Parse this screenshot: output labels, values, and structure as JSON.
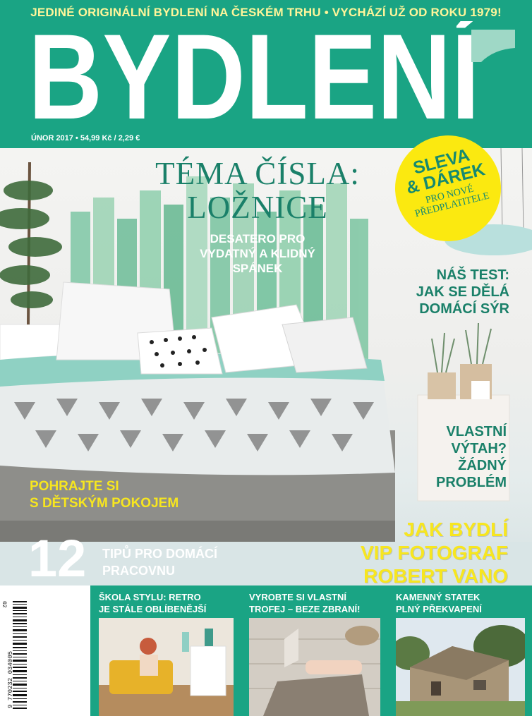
{
  "tagline": "JEDINÉ ORIGINÁLNÍ BYDLENÍ NA ČESKÉM TRHU • VYCHÁZÍ UŽ OD ROKU 1979!",
  "logo": "BYDLENÍ",
  "issue_info": "ÚNOR 2017 • 54,99 Kč / 2,29 €",
  "cover_story": {
    "line1": "TÉMA ČÍSLA:",
    "line2": "LOŽNICE",
    "sub1": "DESATERO PRO",
    "sub2": "VYDATNÝ A KLIDNÝ",
    "sub3": "SPÁNEK"
  },
  "sticker": {
    "line1": "SLEVA",
    "line2": "& DÁREK",
    "line3": "PRO NOVÉ",
    "line4": "PŘEDPLATITELE"
  },
  "test": {
    "line1": "NÁŠ TEST:",
    "line2": "JAK SE DĚLÁ",
    "line3": "DOMÁCÍ SÝR"
  },
  "elevator": {
    "line1": "VLASTNÍ",
    "line2": "VÝTAH?",
    "line3": "ŽÁDNÝ",
    "line4": "PROBLÉM"
  },
  "kids": {
    "line1": "POHRAJTE SI",
    "line2": "S DĚTSKÝM POKOJEM"
  },
  "vip": {
    "line1": "JAK BYDLÍ",
    "line2": "VIP FOTOGRAF",
    "line3": "ROBERT VANO"
  },
  "tips": {
    "number": "12",
    "line1": "TIPŮ PRO DOMÁCÍ",
    "line2": "PRACOVNU"
  },
  "panels": [
    {
      "line1": "ŠKOLA STYLU: RETRO",
      "line2": "JE STÁLE OBLÍBENĚJŠÍ"
    },
    {
      "line1": "VYROBTE SI VLASTNÍ",
      "line2": "TROFEJ – BEZE ZBRANÍ!"
    },
    {
      "line1": "KAMENNÝ STATEK",
      "line2": "PLNÝ PŘEKVAPENÍ"
    }
  ],
  "barcode": {
    "digits": "9 770232 034005",
    "issue_code": "02"
  },
  "colors": {
    "brand_green": "#1aa484",
    "dark_green": "#1a8069",
    "yellow": "#f7e61f",
    "sticker_yellow": "#fbe910"
  }
}
